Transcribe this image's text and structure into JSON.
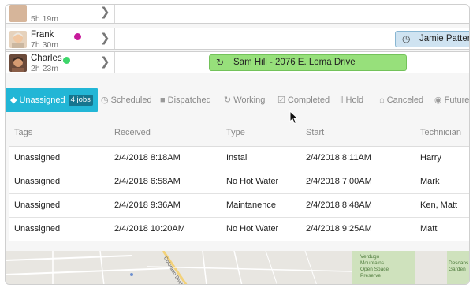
{
  "dispatch": {
    "rows": [
      {
        "name": "",
        "duration": "5h 19m",
        "status_color": ""
      },
      {
        "name": "Frank",
        "duration": "7h 30m",
        "status_color": "#c71a9b"
      },
      {
        "name": "Charles",
        "duration": "2h 23m",
        "status_color": "#3ed66b"
      }
    ],
    "jobs": [
      {
        "label": "Jamie Patter",
        "icon": "clock-icon",
        "color": "#cfe3f1"
      },
      {
        "label": "Sam Hill - 2076 E. Loma Drive",
        "icon": "refresh-icon",
        "color": "#97e07b"
      }
    ]
  },
  "tabs": [
    {
      "label": "Unassigned",
      "badge": "4 jobs",
      "icon": "tag-icon"
    },
    {
      "label": "Scheduled",
      "icon": "clock-icon"
    },
    {
      "label": "Dispatched",
      "icon": "truck-icon"
    },
    {
      "label": "Working",
      "icon": "refresh-icon"
    },
    {
      "label": "Completed",
      "icon": "checkbox-icon"
    },
    {
      "label": "Hold",
      "icon": "pause-icon"
    },
    {
      "label": "Canceled",
      "icon": "trash-icon"
    },
    {
      "label": "Future",
      "icon": "eye-icon"
    }
  ],
  "table": {
    "headers": [
      "Tags",
      "Received",
      "Type",
      "Start",
      "Technician"
    ],
    "rows": [
      [
        "Unassigned",
        "2/4/2018  8:18AM",
        "Install",
        "2/4/2018 8:11AM",
        "Harry"
      ],
      [
        "Unassigned",
        "2/4/2018  6:58AM",
        "No Hot Water",
        "2/4/2018 7:00AM",
        "Mark"
      ],
      [
        "Unassigned",
        "2/4/2018  9:36AM",
        "Maintanence",
        "2/4/2018 8:48AM",
        "Ken, Matt"
      ],
      [
        "Unassigned",
        "2/4/2018  10:20AM",
        "No Hot Water",
        "2/4/2018 9:25AM",
        "Matt"
      ]
    ]
  },
  "map": {
    "labels": [
      "Verdugo",
      "Mountains",
      "Open Space",
      "Preserve",
      "Descans",
      "Garden",
      "Colorado Blvd"
    ]
  },
  "colors": {
    "accent": "#22b6d6",
    "badge": "#16758e"
  }
}
